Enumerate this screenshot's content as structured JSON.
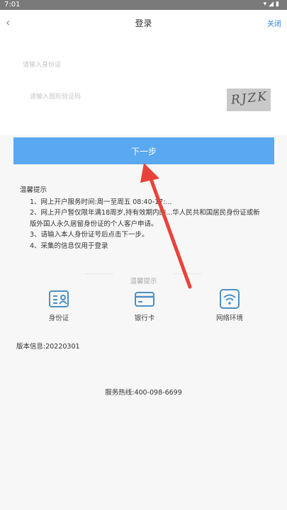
{
  "status_bar": {
    "time": "7:01",
    "icons": [
      "wifi-icon",
      "signal-icon",
      "battery-icon"
    ]
  },
  "header": {
    "title": "登录",
    "close_label": "关闭"
  },
  "form": {
    "id_placeholder": "请输入身份证",
    "captcha_placeholder": "请输入图形验证码",
    "captcha_text": "RJZK"
  },
  "next_button": {
    "label": "下一步",
    "color": "#5aa8f0"
  },
  "tips": {
    "title": "温馨提示",
    "items": [
      "1、网上开户服务时间:周一至周五 08:40-17:...",
      "2、网上开户暂仅限年满18周岁,持有效期内的...华人民共和国居民身份证或新",
      "版外国人永久居留身份证的个人客户申请。",
      "3、请输入本人身份证号后点击下一步。",
      "4、采集的信息仅用于登录"
    ]
  },
  "warm_section": {
    "label": "温馨提示"
  },
  "quick_links": [
    {
      "label": "身份证",
      "icon": "id-card-icon"
    },
    {
      "label": "银行卡",
      "icon": "bank-card-icon"
    },
    {
      "label": "网络环境",
      "icon": "wifi-network-icon"
    }
  ],
  "version": {
    "label": "版本信息:20220301"
  },
  "hotline": {
    "label": "服务热线:400-098-6699"
  },
  "colors": {
    "accent": "#5aa8f0",
    "link": "#2e86de",
    "arrow": "#e8433b",
    "icon": "#4a90c8"
  }
}
